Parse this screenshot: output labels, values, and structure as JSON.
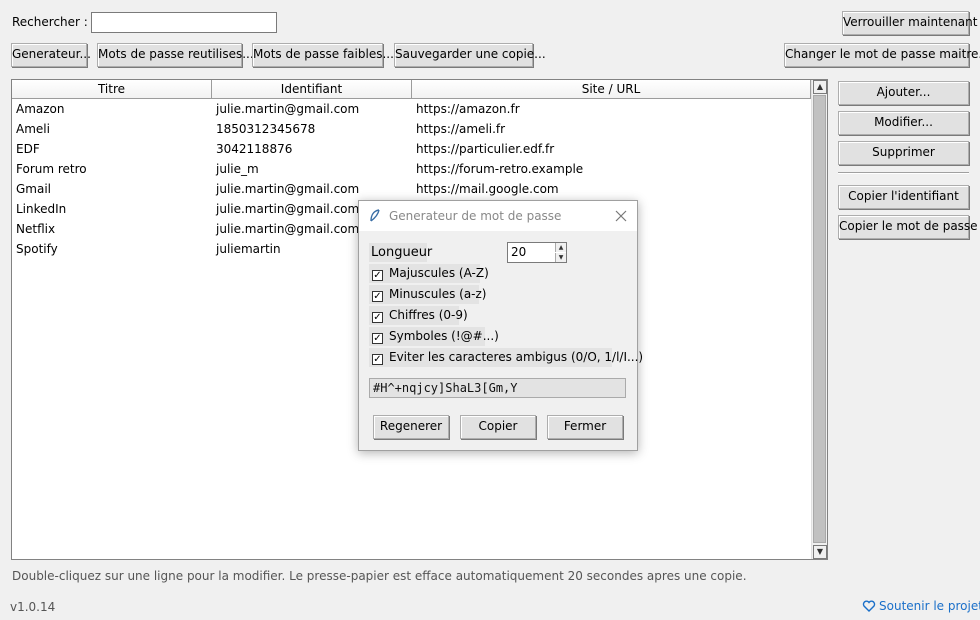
{
  "search": {
    "label": "Rechercher :",
    "value": ""
  },
  "toolbar": {
    "generator": "Generateur...",
    "reused": "Mots de passe reutilises...",
    "weak": "Mots de passe faibles...",
    "backup": "Sauvegarder une copie...",
    "lock": "Verrouiller maintenant",
    "change_master": "Changer le mot de passe maitre..."
  },
  "actions": {
    "add": "Ajouter...",
    "edit": "Modifier...",
    "delete": "Supprimer",
    "copy_id": "Copier l'identifiant",
    "copy_pwd": "Copier le mot de passe"
  },
  "table": {
    "columns": [
      "Titre",
      "Identifiant",
      "Site / URL"
    ],
    "rows": [
      [
        "Amazon",
        "julie.martin@gmail.com",
        "https://amazon.fr"
      ],
      [
        "Ameli",
        "1850312345678",
        "https://ameli.fr"
      ],
      [
        "EDF",
        "3042118876",
        "https://particulier.edf.fr"
      ],
      [
        "Forum retro",
        "julie_m",
        "https://forum-retro.example"
      ],
      [
        "Gmail",
        "julie.martin@gmail.com",
        "https://mail.google.com"
      ],
      [
        "LinkedIn",
        "julie.martin@gmail.com",
        ""
      ],
      [
        "Netflix",
        "julie.martin@gmail.com",
        ""
      ],
      [
        "Spotify",
        "juliemartin",
        ""
      ]
    ]
  },
  "hint": "Double-cliquez sur une ligne pour la modifier. Le presse-papier est efface automatiquement 20 secondes apres une copie.",
  "version": "v1.0.14",
  "support": "Soutenir le projet",
  "dialog": {
    "title": "Generateur de mot de passe",
    "length_label": "Longueur",
    "length_value": "20",
    "options": [
      {
        "label": "Majuscules (A-Z)",
        "checked": true
      },
      {
        "label": "Minuscules (a-z)",
        "checked": true
      },
      {
        "label": "Chiffres (0-9)",
        "checked": true
      },
      {
        "label": "Symboles (!@#...)",
        "checked": true
      },
      {
        "label": "Eviter les caracteres ambigus (0/O, 1/l/I...)",
        "checked": true
      }
    ],
    "password": "#H^+nqjcy]ShaL3[Gm,Y",
    "regenerate": "Regenerer",
    "copy": "Copier",
    "close": "Fermer"
  }
}
